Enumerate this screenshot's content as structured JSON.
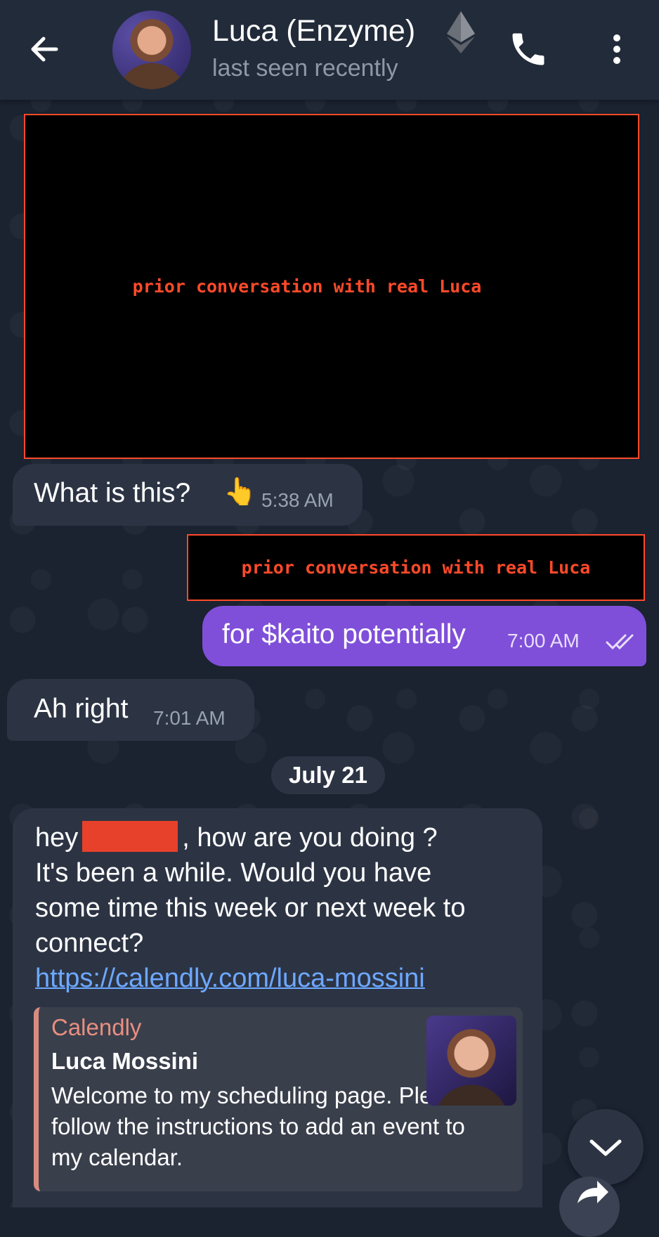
{
  "header": {
    "title": "Luca (Enzyme)",
    "status": "last seen recently",
    "back_icon": "arrow-left-icon",
    "call_icon": "phone-icon",
    "menu_icon": "more-vertical-icon",
    "badge_icon": "ethereum-icon"
  },
  "redactions": {
    "large_label": "prior conversation with real Luca",
    "small_label": "prior conversation with real Luca"
  },
  "messages": [
    {
      "direction": "incoming",
      "text": "What is this?",
      "emoji": "👆",
      "time": "5:38 AM"
    },
    {
      "direction": "outgoing",
      "text": "for $kaito potentially",
      "time": "7:00 AM",
      "status_icon": "double-check-icon"
    },
    {
      "direction": "incoming",
      "text": "Ah right",
      "time": "7:01 AM"
    }
  ],
  "date_separator": "July 21",
  "long_message": {
    "greeting": "hey",
    "greeting_rest": ", how are you doing ?",
    "line2": "It's been a while. Would you have",
    "line3": "some time this week or next week to",
    "line4": "connect?",
    "link": "https://calendly.com/luca-mossini",
    "preview": {
      "site": "Calendly",
      "title": "Luca Mossini",
      "description": "Welcome to my scheduling page. Please follow the instructions to add an event to my calendar."
    }
  },
  "colors": {
    "background": "#1b2230",
    "incoming_bubble": "#2c3444",
    "outgoing_bubble": "#7f4fd9",
    "redaction_border": "#ff4a2a",
    "link": "#6da8ff"
  }
}
